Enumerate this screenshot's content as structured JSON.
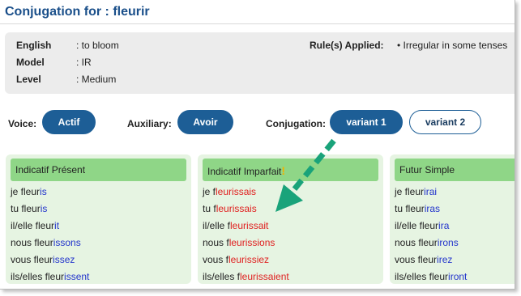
{
  "header": {
    "title_prefix": "Conjugation for : ",
    "verb": "fleurir"
  },
  "info": {
    "english_label": "English",
    "english_value": ": to bloom",
    "model_label": "Model",
    "model_value": ": IR",
    "level_label": "Level",
    "level_value": ": Medium",
    "rules_label": "Rule(s) Applied:",
    "rules_value": "• Irregular in some tenses"
  },
  "controls": {
    "voice_label": "Voice:",
    "voice_value": "Actif",
    "auxiliary_label": "Auxiliary:",
    "auxiliary_value": "Avoir",
    "conjugation_label": "Conjugation:",
    "variant1": "variant 1",
    "variant2": "variant 2"
  },
  "tenses": [
    {
      "title": "Indicatif Présent",
      "forms": [
        {
          "stem": "je fleur",
          "ending": "is"
        },
        {
          "stem": "tu fleur",
          "ending": "is"
        },
        {
          "stem": "il/elle fleur",
          "ending": "it"
        },
        {
          "stem": "nous fleur",
          "ending": "issons"
        },
        {
          "stem": "vous fleur",
          "ending": "issez"
        },
        {
          "stem": "ils/elles fleur",
          "ending": "issent"
        }
      ]
    },
    {
      "title": "Indicatif Imparfait",
      "warning": "!",
      "forms": [
        {
          "stem": "je f",
          "ending": "leurissais"
        },
        {
          "stem": "tu f",
          "ending": "leurissais"
        },
        {
          "stem": "il/elle f",
          "ending": "leurissait"
        },
        {
          "stem": "nous f",
          "ending": "leurissions"
        },
        {
          "stem": "vous f",
          "ending": "leurissiez"
        },
        {
          "stem": "ils/elles f",
          "ending": "leurissaient"
        }
      ]
    },
    {
      "title": "Futur Simple",
      "forms": [
        {
          "stem": "je fleur",
          "ending": "irai"
        },
        {
          "stem": "tu fleur",
          "ending": "iras"
        },
        {
          "stem": "il/elle fleur",
          "ending": "ira"
        },
        {
          "stem": "nous fleur",
          "ending": "irons"
        },
        {
          "stem": "vous fleur",
          "ending": "irez"
        },
        {
          "stem": "ils/elles fleur",
          "ending": "iront"
        }
      ]
    }
  ],
  "colors": {
    "accent": "#1d5e96",
    "tense_header": "#8fd687",
    "card_bg": "#e6f4e2",
    "regular_ending": "#2233cc",
    "irregular_ending": "#e02020",
    "arrow": "#19a37a"
  }
}
